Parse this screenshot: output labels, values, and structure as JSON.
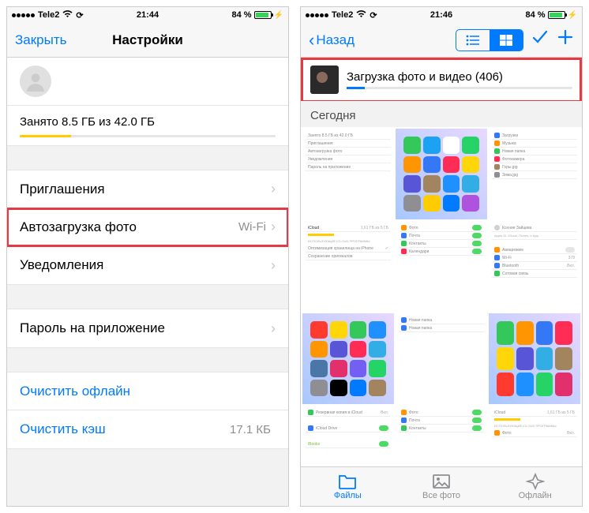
{
  "left": {
    "status": {
      "carrier": "Tele2",
      "time": "21:44",
      "battery_pct": "84 %"
    },
    "nav": {
      "close": "Закрыть",
      "title": "Настройки"
    },
    "storage_text": "Занято 8.5 ГБ из 42.0 ГБ",
    "rows": {
      "invitations": "Приглашения",
      "autoupload": "Автозагрузка фото",
      "autoupload_detail": "Wi-Fi",
      "notifications": "Уведомления",
      "app_password": "Пароль на приложение",
      "clear_offline": "Очистить офлайн",
      "clear_cache": "Очистить кэш",
      "clear_cache_detail": "17.1 КБ"
    }
  },
  "right": {
    "status": {
      "carrier": "Tele2",
      "time": "21:46",
      "battery_pct": "84 %"
    },
    "nav": {
      "back": "Назад"
    },
    "upload_title": "Загрузка фото и видео (406)",
    "section_today": "Сегодня",
    "tabs": {
      "files": "Файлы",
      "all_photos": "Все фото",
      "offline": "Офлайн"
    }
  }
}
